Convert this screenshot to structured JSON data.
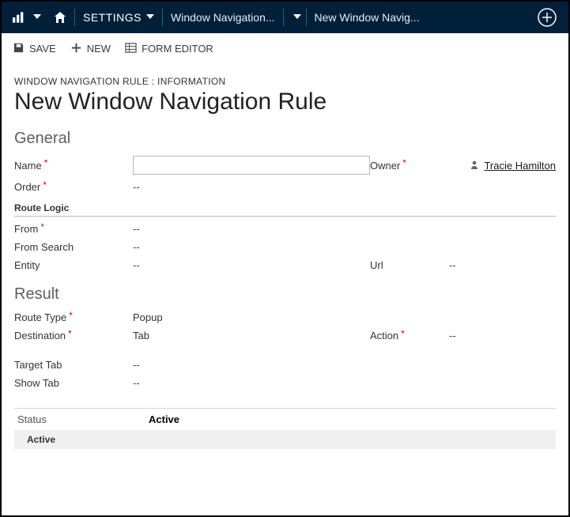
{
  "nav": {
    "settings_label": "SETTINGS",
    "crumb1": "Window Navigation...",
    "crumb2": "New Window Navig..."
  },
  "cmd": {
    "save": "SAVE",
    "new": "NEW",
    "form_editor": "FORM EDITOR"
  },
  "header": {
    "eyebrow": "WINDOW NAVIGATION RULE : INFORMATION",
    "title": "New Window Navigation Rule"
  },
  "sections": {
    "general": "General",
    "route_logic": "Route Logic",
    "result": "Result"
  },
  "labels": {
    "name": "Name",
    "owner": "Owner",
    "order": "Order",
    "from": "From",
    "from_search": "From Search",
    "entity": "Entity",
    "url": "Url",
    "route_type": "Route Type",
    "destination": "Destination",
    "action": "Action",
    "target_tab": "Target Tab",
    "show_tab": "Show Tab",
    "status": "Status"
  },
  "values": {
    "name": "",
    "owner": "Tracie Hamilton",
    "order": "--",
    "from": "--",
    "from_search": "--",
    "entity": "--",
    "url": "--",
    "route_type": "Popup",
    "destination": "Tab",
    "action": "--",
    "target_tab": "--",
    "show_tab": "--",
    "status": "Active",
    "status_sub": "Active"
  },
  "glyphs": {
    "empty": "--",
    "star": "*"
  }
}
